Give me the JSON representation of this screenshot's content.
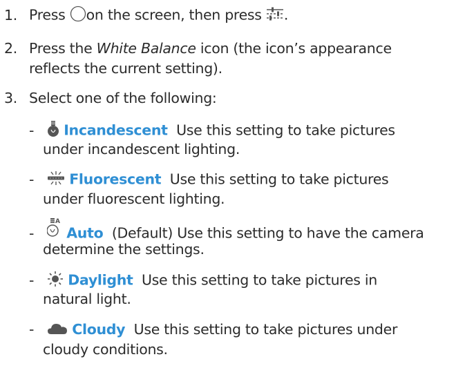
{
  "steps": [
    {
      "num": "1.",
      "pre": "Press",
      "mid": "on the screen, then press",
      "post": ".",
      "icon_a": "circle-button-icon",
      "icon_b": "settings-sliders-icon"
    },
    {
      "num": "2.",
      "pre": "Press the",
      "italic": "White Balance",
      "post": "icon (the icon’s appearance",
      "cont": "reflects the current setting)."
    },
    {
      "num": "3.",
      "text": "Select one of the following:"
    }
  ],
  "options": [
    {
      "dash": "-",
      "icon": "incandescent-bulb-icon",
      "name": "Incandescent",
      "desc": "Use this setting to take pictures",
      "cont": "under incandescent lighting."
    },
    {
      "dash": "-",
      "icon": "fluorescent-tube-icon",
      "name": "Fluorescent",
      "desc": "Use this setting to take pictures",
      "cont": "under fluorescent lighting."
    },
    {
      "dash": "-",
      "icon": "auto-wb-bulb-icon",
      "name": "Auto",
      "desc": "(Default) Use this setting to have the camera",
      "cont": "determine the settings."
    },
    {
      "dash": "-",
      "icon": "daylight-sun-icon",
      "name": "Daylight",
      "desc": "Use this setting to take pictures in",
      "cont": "natural light."
    },
    {
      "dash": "-",
      "icon": "cloudy-cloud-icon",
      "name": "Cloudy",
      "desc": "Use this setting to take pictures under",
      "cont": "cloudy conditions."
    }
  ],
  "icon_labels": {
    "auto_badge": "A"
  },
  "colors": {
    "option_name": "#2f8fd4",
    "text": "#2b2b2b",
    "icon": "#555555"
  }
}
